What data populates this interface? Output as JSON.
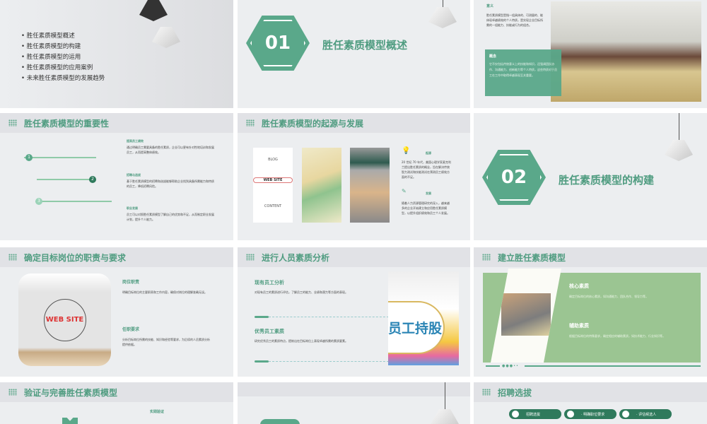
{
  "slide1": {
    "agenda": [
      "胜任素质模型概述",
      "胜任素质模型的构建",
      "胜任素质模型的运用",
      "胜任素质模型的应用案例",
      "未来胜任素质模型的发展趋势"
    ]
  },
  "slide2": {
    "number": "01",
    "title": "胜任素质模型概述"
  },
  "slide3": {
    "meaning_title": "意义",
    "meaning_text": "胜任素质模型是指一组具体的、可测量的、能体现卓越绩效的个人特质，是实现企业目标所需的一组能力、技能或行为的组合。",
    "concept_title": "概念",
    "concept_text": "它不仅包括传统意义上的技能和知识，还强调团队协作、沟通能力、创新能力等个人特质，这些特质对于员工在工作中取得卓越表现至关重要。"
  },
  "slide4": {
    "title": "胜任素质模型的重要性",
    "steps": [
      "1",
      "2",
      "3"
    ],
    "items": [
      {
        "title": "提高员工绩效",
        "text": "通过明确员工需要具备的胜任素质，企业可以更有针对性地培训和发展员工，从而提高整体绩效。"
      },
      {
        "title": "招聘与选拔",
        "text": "基于胜任素质模型的招聘和选拔能够帮助企业找到具备所需能力和特质的员工，降低招聘风险。"
      },
      {
        "title": "职业发展",
        "text": "员工可以对照胜任素质模型了解自己的优势和不足，从而制定职业发展计划，提升个人能力。"
      }
    ]
  },
  "slide5": {
    "title": "胜任素质模型的起源与发展",
    "origin_title": "起源",
    "origin_text": "20 世纪 70 年代，美国心理学家麦克利兰提出胜任素质的概念，旨在解决传统智力测试和技能测试在预测员工绩效方面的不足。",
    "dev_title": "发展",
    "dev_text": "随着人力资源管理研究的深入，越来越多的企业开始建立和应用胜任素质模型，以提升组织绩效和员工个人发展。",
    "img_text": [
      "BLOG",
      "WEB SITE",
      "CONTENT"
    ]
  },
  "slide6": {
    "number": "02",
    "title": "胜任素质模型的构建"
  },
  "slide7": {
    "title": "确定目标岗位的职责与要求",
    "img_text": "WEB SITE",
    "items": [
      {
        "title": "岗位职责",
        "text": "明确目标岗位的主要职责和工作内容，确保对岗位的理解准确无误。"
      },
      {
        "title": "任职要求",
        "text": "分析目标岗位所需的技能、知识和经验等要求，为后续的人员素质分析提供依据。"
      }
    ]
  },
  "slide8": {
    "title": "进行人员素质分析",
    "img_text": "员工持股",
    "items": [
      {
        "title": "现有员工分析",
        "text": "对现有员工的素质进行评估，了解员工的能力、业绩和潜力等方面的表现。"
      },
      {
        "title": "优秀员工素质",
        "text": "研究优秀员工的素质特点，提炼出在目标岗位上表现卓越所需的素质要素。"
      }
    ]
  },
  "slide9": {
    "title": "建立胜任素质模型",
    "items": [
      {
        "title": "核心素质",
        "text": "确定目标岗位的核心素质，如沟通能力、团队合作、领导力等。"
      },
      {
        "title": "辅助素质",
        "text": "根据目标岗位的特殊要求，确定相应的辅助素质，如技术能力、行业知识等。"
      }
    ]
  },
  "slide10": {
    "title": "验证与完善胜任素质模型",
    "sub": "实践验证"
  },
  "slide12": {
    "title": "招聘选拔",
    "steps": [
      "招聘选拔",
      "· 明确职位要求",
      "· 评估候选人"
    ]
  },
  "colors": {
    "accent": "#5aa88a",
    "dark": "#2f7a5c",
    "panel": "#9bc592"
  }
}
